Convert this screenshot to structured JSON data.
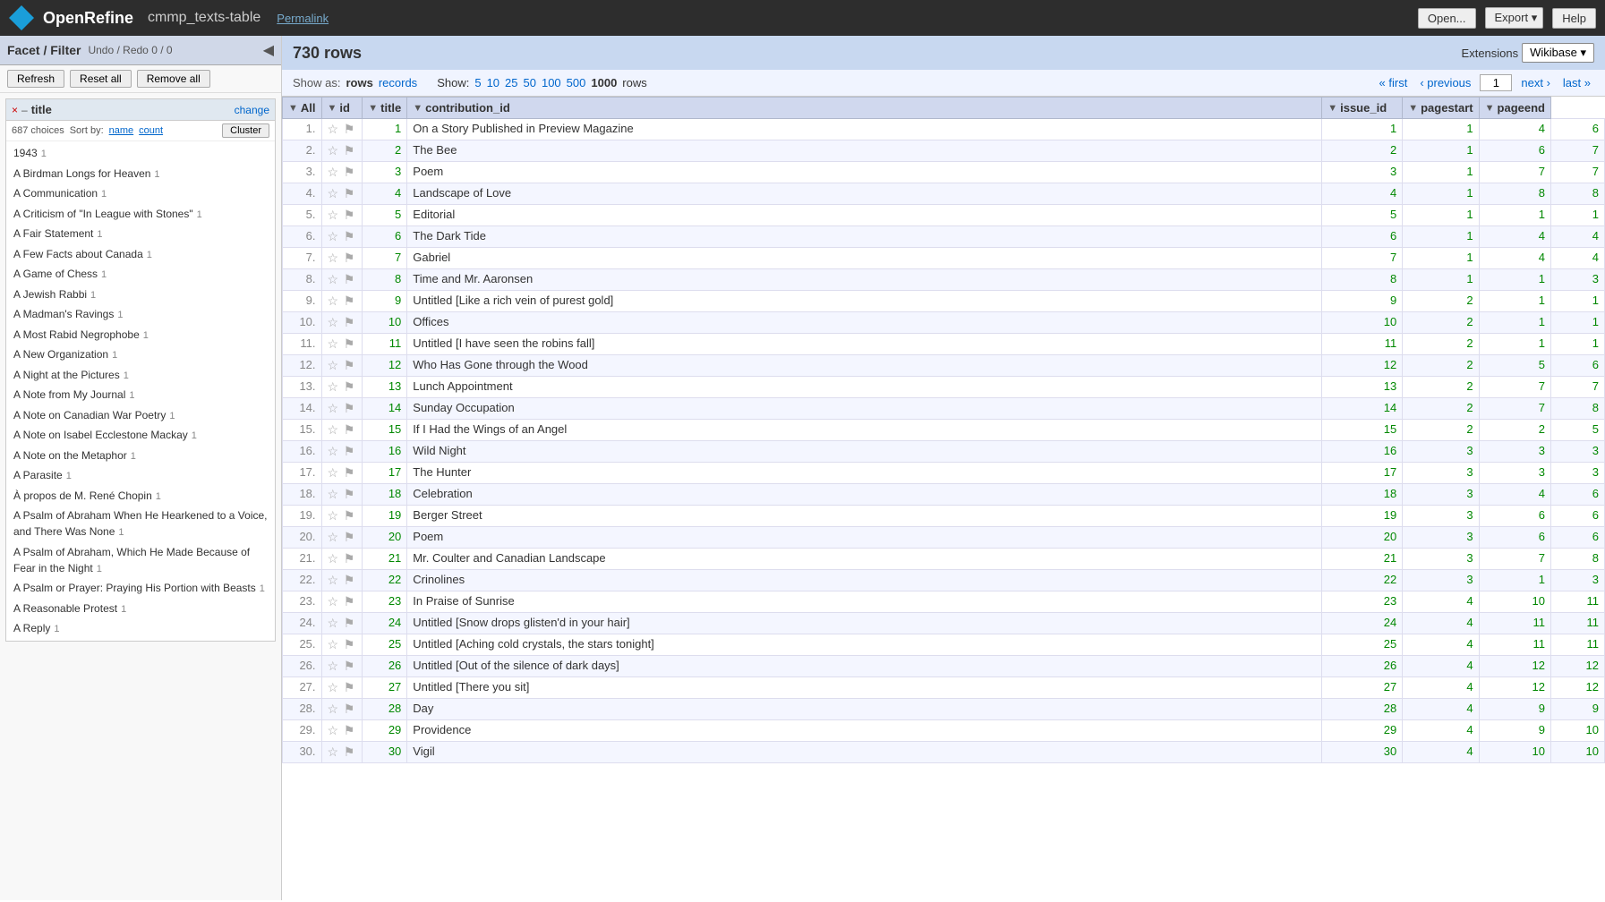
{
  "header": {
    "app_name": "OpenRefine",
    "project_name": "cmmp_texts-table",
    "permalink_label": "Permalink",
    "open_label": "Open...",
    "export_label": "Export",
    "export_arrow": "▾",
    "help_label": "Help"
  },
  "facet_panel": {
    "title": "Facet / Filter",
    "undo_redo_label": "Undo / Redo",
    "undo_redo_value": "0 / 0",
    "refresh_label": "Refresh",
    "reset_all_label": "Reset all",
    "remove_all_label": "Remove all"
  },
  "facet_widget": {
    "close": "×",
    "minimize": "–",
    "name": "title",
    "change_label": "change",
    "choices": "687 choices",
    "sort_by_label": "Sort by:",
    "sort_name": "name",
    "sort_count": "count",
    "cluster_label": "Cluster",
    "items": [
      {
        "label": "1943",
        "count": "1"
      },
      {
        "label": "A Birdman Longs for Heaven",
        "count": "1"
      },
      {
        "label": "A Communication",
        "count": "1"
      },
      {
        "label": "A Criticism of \"In League with Stones\"",
        "count": "1"
      },
      {
        "label": "A Fair Statement",
        "count": "1"
      },
      {
        "label": "A Few Facts about Canada",
        "count": "1"
      },
      {
        "label": "A Game of Chess",
        "count": "1"
      },
      {
        "label": "A Jewish Rabbi",
        "count": "1"
      },
      {
        "label": "A Madman's Ravings",
        "count": "1"
      },
      {
        "label": "A Most Rabid Negrophobe",
        "count": "1"
      },
      {
        "label": "A New Organization",
        "count": "1"
      },
      {
        "label": "A Night at the Pictures",
        "count": "1"
      },
      {
        "label": "A Note from My Journal",
        "count": "1"
      },
      {
        "label": "A Note on Canadian War Poetry",
        "count": "1"
      },
      {
        "label": "A Note on Isabel Ecclestone Mackay",
        "count": "1"
      },
      {
        "label": "A Note on the Metaphor",
        "count": "1"
      },
      {
        "label": "A Parasite",
        "count": "1"
      },
      {
        "label": "À propos de M. René Chopin",
        "count": "1"
      },
      {
        "label": "A Psalm of Abraham When He Hearkened to a Voice, and There Was None",
        "count": "1"
      },
      {
        "label": "A Psalm of Abraham, Which He Made Because of Fear in the Night",
        "count": "1"
      },
      {
        "label": "A Psalm or Prayer: Praying His Portion with Beasts",
        "count": "1"
      },
      {
        "label": "A Reasonable Protest",
        "count": "1"
      },
      {
        "label": "A Reply",
        "count": "1"
      }
    ]
  },
  "row_count_bar": {
    "count": "730 rows",
    "extensions_label": "Extensions",
    "wikibase_label": "Wikibase ▾"
  },
  "show_bar": {
    "show_as_label": "Show as:",
    "rows_label": "rows",
    "records_label": "records",
    "show_label": "Show:",
    "show_options": [
      "5",
      "10",
      "25",
      "50",
      "100",
      "500",
      "1000"
    ],
    "show_bold": "1000",
    "rows_unit": "rows",
    "first_label": "« first",
    "prev_label": "‹ previous",
    "page_value": "1",
    "next_label": "next ›",
    "last_label": "last »"
  },
  "table": {
    "columns": [
      {
        "key": "all",
        "label": "All"
      },
      {
        "key": "id_col",
        "label": "id"
      },
      {
        "key": "title",
        "label": "title"
      },
      {
        "key": "contribution_id",
        "label": "contribution_id"
      },
      {
        "key": "issue_id",
        "label": "issue_id"
      },
      {
        "key": "pagestart",
        "label": "pagestart"
      },
      {
        "key": "pageend",
        "label": "pageend"
      }
    ],
    "rows": [
      {
        "num": "1.",
        "id": "1",
        "title": "On a Story Published in Preview Magazine",
        "contribution_id": "1",
        "issue_id": "1",
        "pagestart": "4",
        "pageend": "6"
      },
      {
        "num": "2.",
        "id": "2",
        "title": "The Bee",
        "contribution_id": "2",
        "issue_id": "1",
        "pagestart": "6",
        "pageend": "7"
      },
      {
        "num": "3.",
        "id": "3",
        "title": "Poem",
        "contribution_id": "3",
        "issue_id": "1",
        "pagestart": "7",
        "pageend": "7"
      },
      {
        "num": "4.",
        "id": "4",
        "title": "Landscape of Love",
        "contribution_id": "4",
        "issue_id": "1",
        "pagestart": "8",
        "pageend": "8"
      },
      {
        "num": "5.",
        "id": "5",
        "title": "Editorial",
        "contribution_id": "5",
        "issue_id": "1",
        "pagestart": "1",
        "pageend": "1"
      },
      {
        "num": "6.",
        "id": "6",
        "title": "The Dark Tide",
        "contribution_id": "6",
        "issue_id": "1",
        "pagestart": "4",
        "pageend": "4"
      },
      {
        "num": "7.",
        "id": "7",
        "title": "Gabriel",
        "contribution_id": "7",
        "issue_id": "1",
        "pagestart": "4",
        "pageend": "4"
      },
      {
        "num": "8.",
        "id": "8",
        "title": "Time and Mr. Aaronsen",
        "contribution_id": "8",
        "issue_id": "1",
        "pagestart": "1",
        "pageend": "3"
      },
      {
        "num": "9.",
        "id": "9",
        "title": "Untitled [Like a rich vein of purest gold]",
        "contribution_id": "9",
        "issue_id": "2",
        "pagestart": "1",
        "pageend": "1"
      },
      {
        "num": "10.",
        "id": "10",
        "title": "Offices",
        "contribution_id": "10",
        "issue_id": "2",
        "pagestart": "1",
        "pageend": "1"
      },
      {
        "num": "11.",
        "id": "11",
        "title": "Untitled [I have seen the robins fall]",
        "contribution_id": "11",
        "issue_id": "2",
        "pagestart": "1",
        "pageend": "1"
      },
      {
        "num": "12.",
        "id": "12",
        "title": "Who Has Gone through the Wood",
        "contribution_id": "12",
        "issue_id": "2",
        "pagestart": "5",
        "pageend": "6"
      },
      {
        "num": "13.",
        "id": "13",
        "title": "Lunch Appointment",
        "contribution_id": "13",
        "issue_id": "2",
        "pagestart": "7",
        "pageend": "7"
      },
      {
        "num": "14.",
        "id": "14",
        "title": "Sunday Occupation",
        "contribution_id": "14",
        "issue_id": "2",
        "pagestart": "7",
        "pageend": "8"
      },
      {
        "num": "15.",
        "id": "15",
        "title": "If I Had the Wings of an Angel",
        "contribution_id": "15",
        "issue_id": "2",
        "pagestart": "2",
        "pageend": "5"
      },
      {
        "num": "16.",
        "id": "16",
        "title": "Wild Night",
        "contribution_id": "16",
        "issue_id": "3",
        "pagestart": "3",
        "pageend": "3"
      },
      {
        "num": "17.",
        "id": "17",
        "title": "The Hunter",
        "contribution_id": "17",
        "issue_id": "3",
        "pagestart": "3",
        "pageend": "3"
      },
      {
        "num": "18.",
        "id": "18",
        "title": "Celebration",
        "contribution_id": "18",
        "issue_id": "3",
        "pagestart": "4",
        "pageend": "6"
      },
      {
        "num": "19.",
        "id": "19",
        "title": "Berger Street",
        "contribution_id": "19",
        "issue_id": "3",
        "pagestart": "6",
        "pageend": "6"
      },
      {
        "num": "20.",
        "id": "20",
        "title": "Poem",
        "contribution_id": "20",
        "issue_id": "3",
        "pagestart": "6",
        "pageend": "6"
      },
      {
        "num": "21.",
        "id": "21",
        "title": "Mr. Coulter and Canadian Landscape",
        "contribution_id": "21",
        "issue_id": "3",
        "pagestart": "7",
        "pageend": "8"
      },
      {
        "num": "22.",
        "id": "22",
        "title": "Crinolines",
        "contribution_id": "22",
        "issue_id": "3",
        "pagestart": "1",
        "pageend": "3"
      },
      {
        "num": "23.",
        "id": "23",
        "title": "In Praise of Sunrise",
        "contribution_id": "23",
        "issue_id": "4",
        "pagestart": "10",
        "pageend": "11"
      },
      {
        "num": "24.",
        "id": "24",
        "title": "Untitled [Snow drops glisten'd in your hair]",
        "contribution_id": "24",
        "issue_id": "4",
        "pagestart": "11",
        "pageend": "11"
      },
      {
        "num": "25.",
        "id": "25",
        "title": "Untitled [Aching cold crystals, the stars tonight]",
        "contribution_id": "25",
        "issue_id": "4",
        "pagestart": "11",
        "pageend": "11"
      },
      {
        "num": "26.",
        "id": "26",
        "title": "Untitled [Out of the silence of dark days]",
        "contribution_id": "26",
        "issue_id": "4",
        "pagestart": "12",
        "pageend": "12"
      },
      {
        "num": "27.",
        "id": "27",
        "title": "Untitled [There you sit]",
        "contribution_id": "27",
        "issue_id": "4",
        "pagestart": "12",
        "pageend": "12"
      },
      {
        "num": "28.",
        "id": "28",
        "title": "Day",
        "contribution_id": "28",
        "issue_id": "4",
        "pagestart": "9",
        "pageend": "9"
      },
      {
        "num": "29.",
        "id": "29",
        "title": "Providence",
        "contribution_id": "29",
        "issue_id": "4",
        "pagestart": "9",
        "pageend": "10"
      },
      {
        "num": "30.",
        "id": "30",
        "title": "Vigil",
        "contribution_id": "30",
        "issue_id": "4",
        "pagestart": "10",
        "pageend": "10"
      }
    ]
  }
}
